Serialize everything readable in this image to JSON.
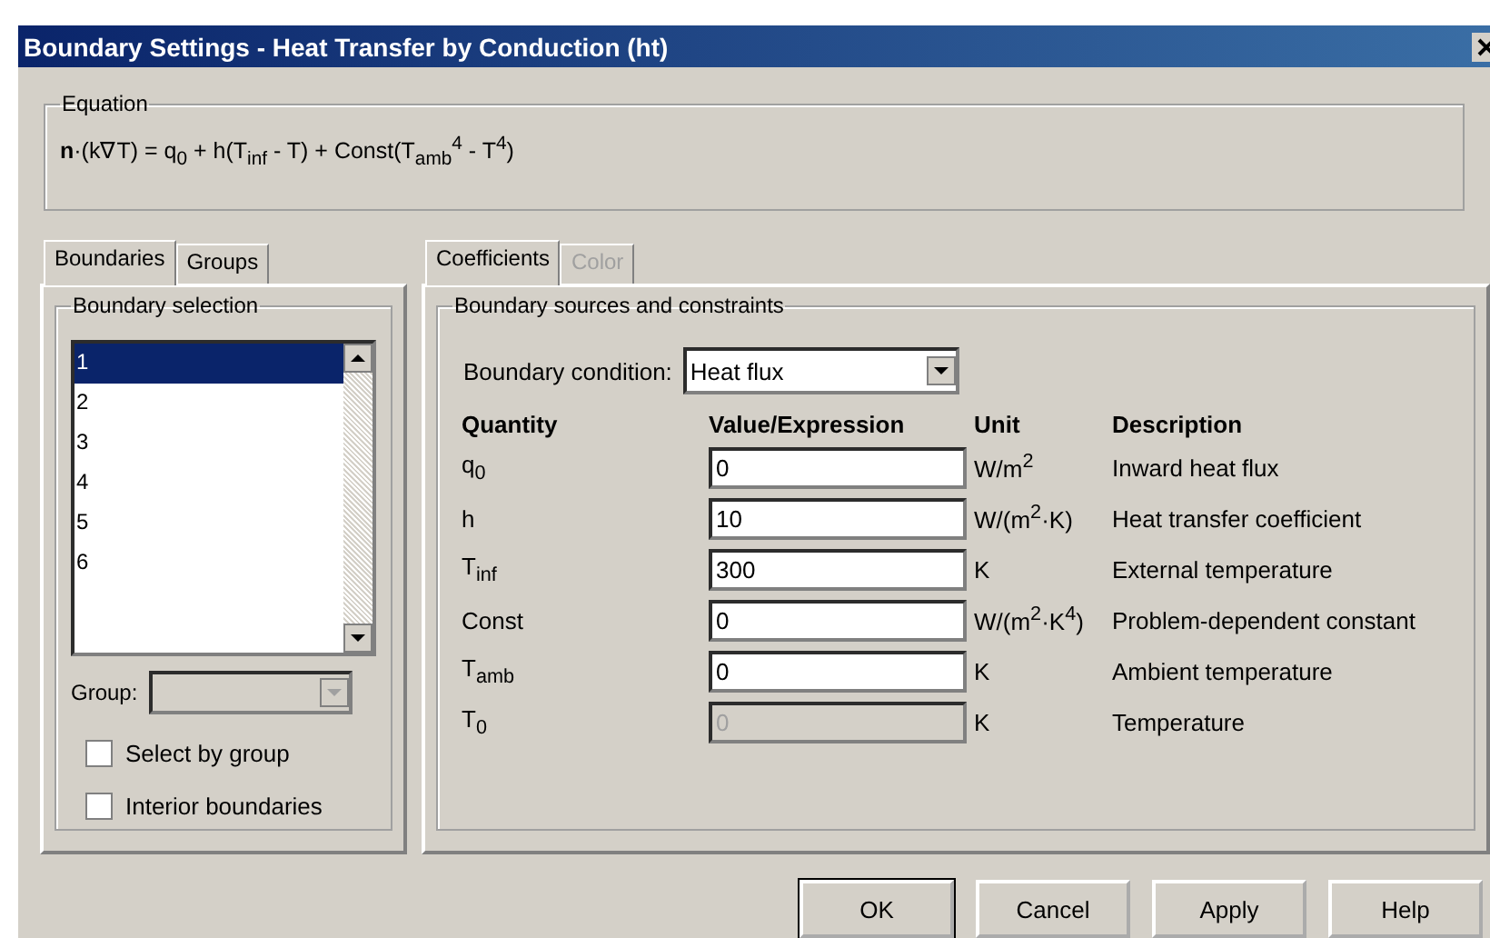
{
  "window": {
    "title": "Boundary Settings - Heat Transfer by Conduction (ht)"
  },
  "equation": {
    "legend": "Equation",
    "formula": "**n**·(k∇T) = q$_{0}$ + h(T$_{inf}$ - T) + Const(T$_{amb}$$^{4}$ - T$^{4}$)"
  },
  "left_tabs": [
    {
      "label": "Boundaries",
      "selected": true
    },
    {
      "label": "Groups",
      "selected": false
    }
  ],
  "boundary_selection": {
    "legend": "Boundary selection",
    "items": [
      {
        "label": "1",
        "selected": true
      },
      {
        "label": "2",
        "selected": false
      },
      {
        "label": "3",
        "selected": false
      },
      {
        "label": "4",
        "selected": false
      },
      {
        "label": "5",
        "selected": false
      },
      {
        "label": "6",
        "selected": false
      }
    ],
    "group_label": "Group:",
    "checkboxes": [
      {
        "label": "Select by group",
        "checked": false
      },
      {
        "label": "Interior boundaries",
        "checked": false
      }
    ]
  },
  "right_tabs": [
    {
      "label": "Coefficients",
      "selected": true,
      "disabled": false
    },
    {
      "label": "Color",
      "selected": false,
      "disabled": true
    }
  ],
  "coefficients": {
    "legend": "Boundary sources and constraints",
    "condition_label": "Boundary condition:",
    "condition_value": "Heat flux",
    "columns": [
      "Quantity",
      "Value/Expression",
      "Unit",
      "Description"
    ],
    "rows": [
      {
        "quantity": "q$_{0}$",
        "value": "0",
        "unit": "W/m$^{2}$",
        "description": "Inward heat flux",
        "disabled": false
      },
      {
        "quantity": "h",
        "value": "10",
        "unit": "W/(m$^{2}$·K)",
        "description": "Heat transfer coefficient",
        "disabled": false
      },
      {
        "quantity": "T$_{inf}$",
        "value": "300",
        "unit": "K",
        "description": "External temperature",
        "disabled": false
      },
      {
        "quantity": "Const",
        "value": "0",
        "unit": "W/(m$^{2}$·K$^{4}$)",
        "description": "Problem-dependent constant",
        "disabled": false
      },
      {
        "quantity": "T$_{amb}$",
        "value": "0",
        "unit": "K",
        "description": "Ambient temperature",
        "disabled": false
      },
      {
        "quantity": "T$_{0}$",
        "value": "0",
        "unit": "K",
        "description": "Temperature",
        "disabled": true
      }
    ]
  },
  "buttons": [
    "OK",
    "Cancel",
    "Apply",
    "Help"
  ]
}
